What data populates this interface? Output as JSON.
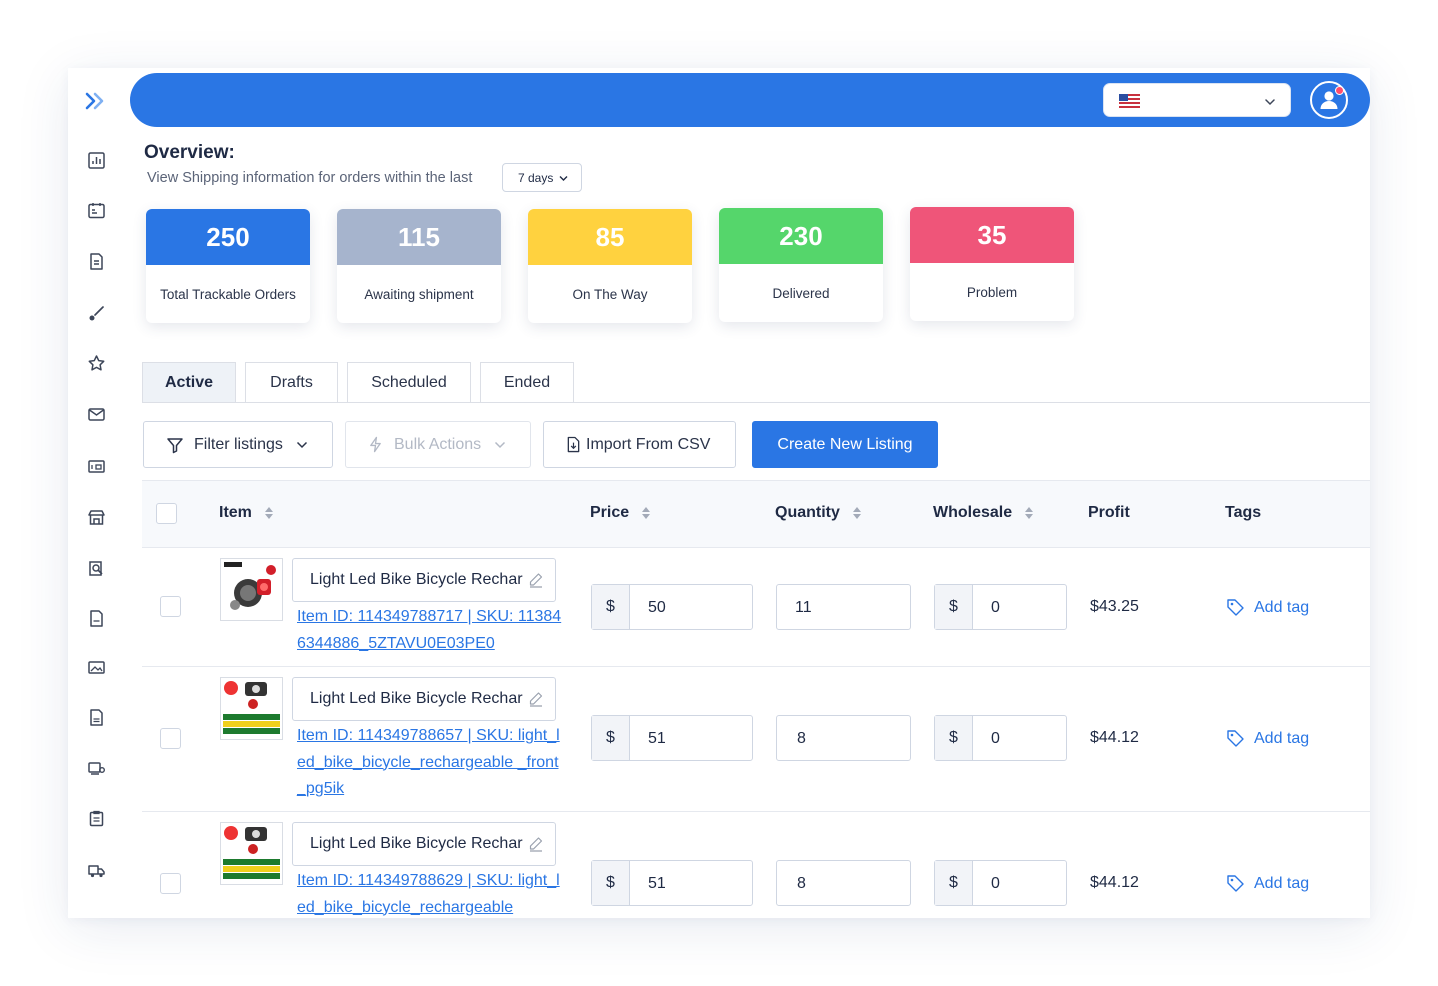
{
  "icons": {
    "sidebar": [
      "collapse-icon",
      "analytics-icon",
      "calendar-icon",
      "document-icon",
      "brush-icon",
      "star-icon",
      "mail-icon",
      "display-icon",
      "store-icon",
      "search-file-icon",
      "pdf-icon",
      "image-icon",
      "sheet-icon",
      "settings-monitor-icon",
      "clipboard-icon",
      "truck-icon"
    ]
  },
  "colors": {
    "topbar": "#2a76e4",
    "primary": "#2a76e4",
    "stat_total": "#2a76e4",
    "stat_awaiting": "#a6b4cd",
    "stat_on_the_way": "#ffd23f",
    "stat_delivered": "#55d66b",
    "stat_problem": "#ef5579"
  },
  "overview": {
    "title": "Overview:",
    "subtitle": "View Shipping information for orders within the last",
    "range": "7 days"
  },
  "stats": [
    {
      "value": "250",
      "label": "Total Trackable Orders"
    },
    {
      "value": "115",
      "label": "Awaiting shipment"
    },
    {
      "value": "85",
      "label": "On The Way"
    },
    {
      "value": "230",
      "label": "Delivered"
    },
    {
      "value": "35",
      "label": "Problem"
    }
  ],
  "tabs": [
    "Active",
    "Drafts",
    "Scheduled",
    "Ended"
  ],
  "actions": {
    "filter": "Filter listings",
    "bulk": "Bulk Actions",
    "import": "Import From CSV",
    "create": "Create New Listing"
  },
  "table": {
    "headers": {
      "item": "Item",
      "price": "Price",
      "quantity": "Quantity",
      "wholesale": "Wholesale",
      "profit": "Profit",
      "tags": "Tags"
    },
    "currency": "$",
    "add_tag": "Add tag",
    "rows": [
      {
        "title": "Light Led Bike Bicycle Rechar",
        "link": "Item ID: 114349788717 | SKU: 113846344886_5ZTAVU0E03PE0",
        "price": "50",
        "quantity": "11",
        "wholesale": "0",
        "profit": "$43.25"
      },
      {
        "title": "Light Led Bike Bicycle Rechar",
        "link": "Item ID: 114349788657 | SKU: light_led_bike_bicycle_rechargeable _front_pg5ik",
        "price": "51",
        "quantity": "8",
        "wholesale": "0",
        "profit": "$44.12"
      },
      {
        "title": "Light Led Bike Bicycle Rechar",
        "link": "Item ID: 114349788629 | SKU: light_led_bike_bicycle_rechargeable",
        "price": "51",
        "quantity": "8",
        "wholesale": "0",
        "profit": "$44.12"
      }
    ]
  }
}
